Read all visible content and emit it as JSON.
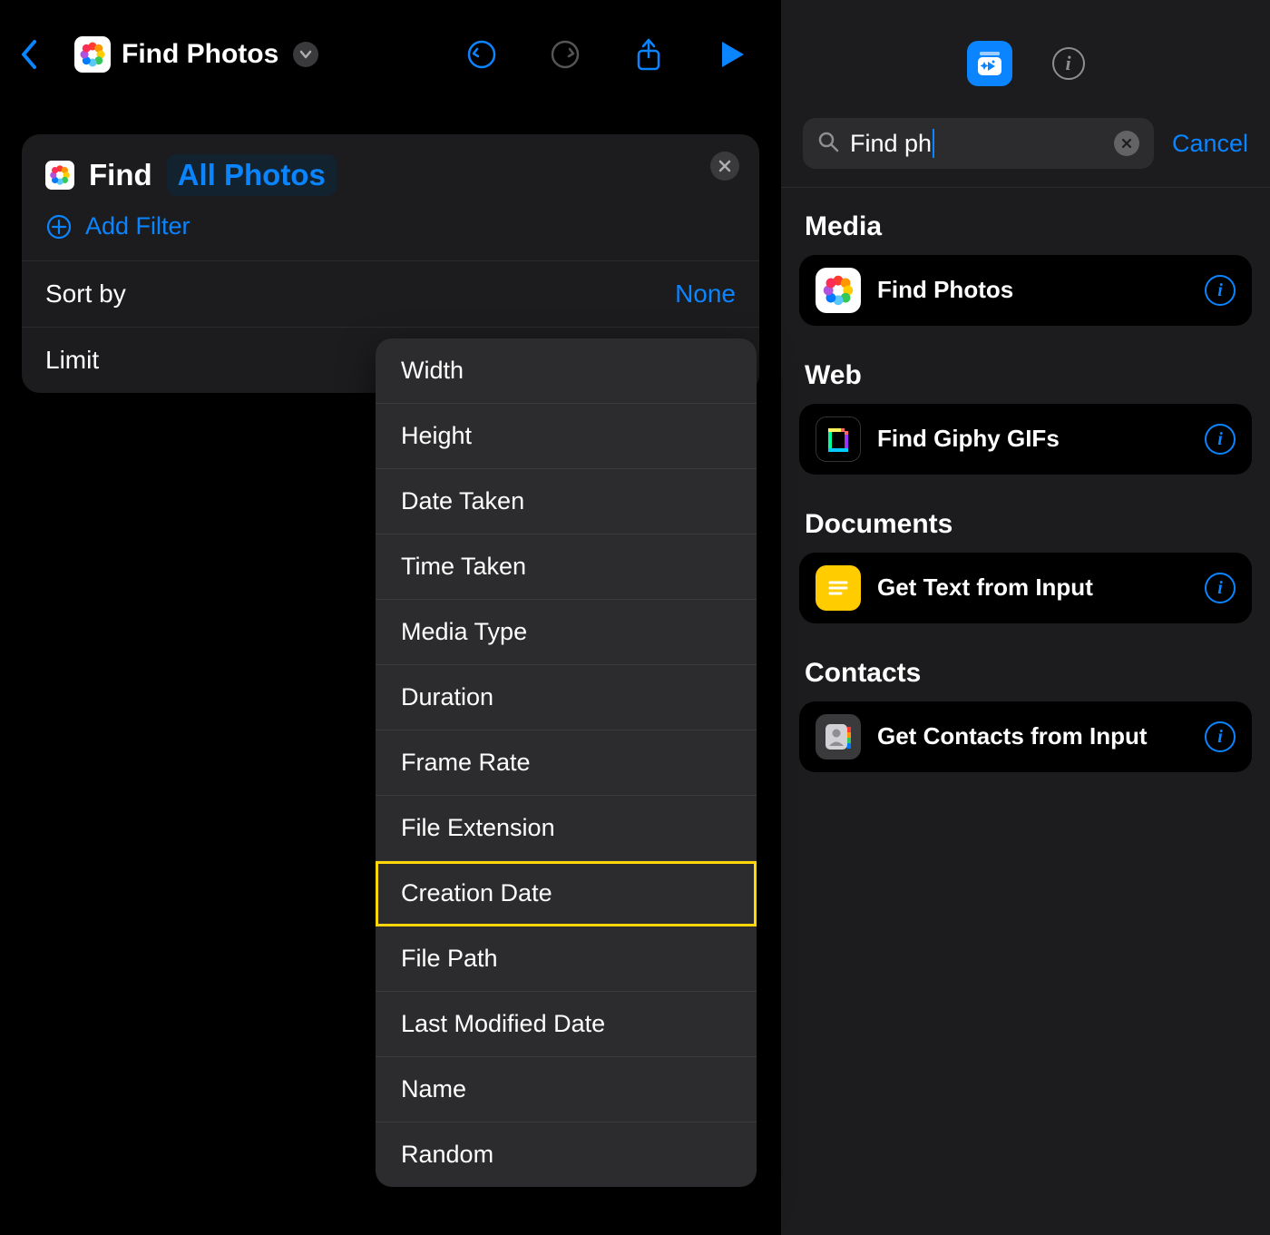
{
  "header": {
    "title": "Find Photos"
  },
  "action_block": {
    "find_label": "Find",
    "token": "All Photos",
    "add_filter": "Add Filter",
    "rows": {
      "sort_by_label": "Sort by",
      "sort_by_value": "None",
      "limit_label": "Limit"
    }
  },
  "sort_menu": [
    "Width",
    "Height",
    "Date Taken",
    "Time Taken",
    "Media Type",
    "Duration",
    "Frame Rate",
    "File Extension",
    "Creation Date",
    "File Path",
    "Last Modified Date",
    "Name",
    "Random"
  ],
  "sort_menu_highlighted_index": 8,
  "right": {
    "search_text": "Find ph",
    "cancel": "Cancel",
    "sections": [
      {
        "label": "Media",
        "action": "Find Photos",
        "icon": "photos"
      },
      {
        "label": "Web",
        "action": "Find Giphy GIFs",
        "icon": "giphy"
      },
      {
        "label": "Documents",
        "action": "Get Text from Input",
        "icon": "text"
      },
      {
        "label": "Contacts",
        "action": "Get Contacts from Input",
        "icon": "contacts"
      }
    ]
  }
}
